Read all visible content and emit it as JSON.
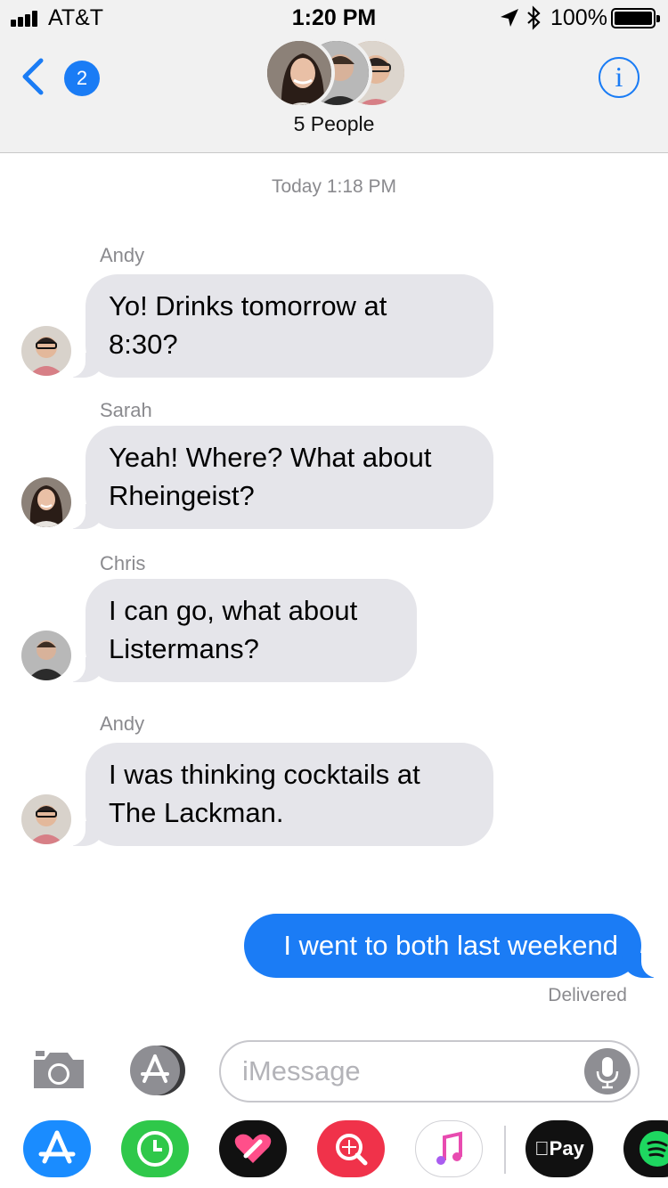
{
  "status_bar": {
    "carrier": "AT&T",
    "time": "1:20 PM",
    "battery_percent": "100%"
  },
  "header": {
    "back_badge_count": "2",
    "group_title": "5 People",
    "info_icon_glyph": "i",
    "avatar_icons": [
      "sarah-avatar-icon",
      "chris-avatar-icon",
      "andy-avatar-icon"
    ]
  },
  "conversation": {
    "timestamp": "Today 1:18 PM",
    "messages": [
      {
        "sender": "Andy",
        "lines": [
          "Yo! Drinks tomorrow at",
          "8:30?"
        ]
      },
      {
        "sender": "Sarah",
        "lines": [
          "Yeah! Where? What about",
          "Rheingeist?"
        ]
      },
      {
        "sender": "Chris",
        "lines": [
          "I can go, what about",
          "Listermans?"
        ]
      },
      {
        "sender": "Andy",
        "lines": [
          "I was thinking cocktails at",
          "The Lackman."
        ]
      }
    ],
    "outgoing": {
      "text": "I went to both last weekend",
      "status": "Delivered"
    }
  },
  "input_bar": {
    "placeholder": "iMessage",
    "value": ""
  },
  "app_drawer": {
    "apps": [
      {
        "name": "App Store",
        "icon": "app-store-icon",
        "color": "#1a8cff"
      },
      {
        "name": "Clock",
        "icon": "clock-icon",
        "color": "#2fc84a"
      },
      {
        "name": "Digital Touch",
        "icon": "digital-touch-icon",
        "color": "#111111"
      },
      {
        "name": "Images",
        "icon": "web-search-icon",
        "color": "#f0324a"
      },
      {
        "name": "Music",
        "icon": "music-icon",
        "color": "#ffffff"
      },
      {
        "name": "Apple Pay",
        "icon": "apple-pay-icon",
        "color": "#111111",
        "label": "Pay"
      },
      {
        "name": "Spotify",
        "icon": "spotify-icon",
        "color": "#111111"
      }
    ]
  },
  "colors": {
    "accent": "#1a7cf5",
    "incoming_bubble": "#e5e5ea",
    "outgoing_bubble": "#1b7cf5",
    "secondary_text": "#8a8a8e"
  }
}
